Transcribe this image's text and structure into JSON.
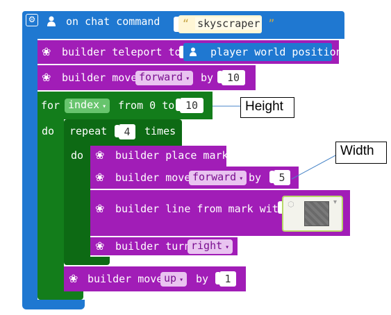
{
  "event": {
    "label": "on chat command",
    "quote_open": "“",
    "command": "skyscraper",
    "quote_close": "”"
  },
  "teleport": {
    "label": "builder teleport to",
    "target": "player world position"
  },
  "move1": {
    "label": "builder move",
    "direction": "forward",
    "by": "by",
    "amount": "10"
  },
  "for_loop": {
    "for": "for",
    "variable": "index",
    "from": "from 0 to",
    "to": "10",
    "do": "do"
  },
  "repeat": {
    "label": "repeat",
    "count": "4",
    "times": "times",
    "do": "do"
  },
  "place_mark": {
    "label": "builder place mark"
  },
  "move2": {
    "label": "builder move",
    "direction": "forward",
    "by": "by",
    "amount": "5"
  },
  "line": {
    "label": "builder line from mark with"
  },
  "turn": {
    "label": "builder turn",
    "direction": "right"
  },
  "move3": {
    "label": "builder move",
    "direction": "up",
    "by": "by",
    "amount": "1"
  },
  "annotations": {
    "height": "Height",
    "width": "Width"
  },
  "colors": {
    "event_blue": "#1f78d1",
    "builder_purple": "#a11db7",
    "loop_green": "#137d1b",
    "string_chip": "#fff6d5"
  }
}
